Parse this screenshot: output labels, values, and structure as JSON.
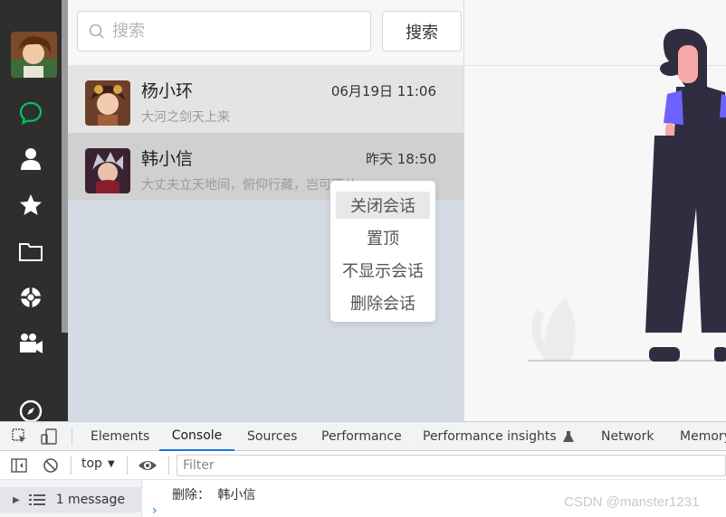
{
  "sidebar": {
    "icons": [
      "chat-icon",
      "contacts-icon",
      "favorites-icon",
      "folder-icon",
      "moments-icon",
      "video-icon",
      "discover-icon"
    ],
    "active_color": "#07c160"
  },
  "search": {
    "placeholder": "搜索",
    "button_label": "搜索"
  },
  "conversations": [
    {
      "name": "杨小环",
      "time": "06月19日 11:06",
      "message": "大河之剑天上来"
    },
    {
      "name": "韩小信",
      "time": "昨天 18:50",
      "message": "大丈夫立天地间，俯仰行藏，岂可不从..."
    }
  ],
  "context_menu": {
    "items": [
      "关闭会话",
      "置顶",
      "不显示会话",
      "删除会话"
    ]
  },
  "devtools": {
    "tabs": [
      "Elements",
      "Console",
      "Sources",
      "Performance",
      "Performance insights",
      "Network",
      "Memory"
    ],
    "active_tab": "Console",
    "context_select": "top",
    "filter_placeholder": "Filter",
    "messages_label": "1 message",
    "log_line": "删除：  韩小信"
  },
  "watermark": "CSDN @manster1231"
}
